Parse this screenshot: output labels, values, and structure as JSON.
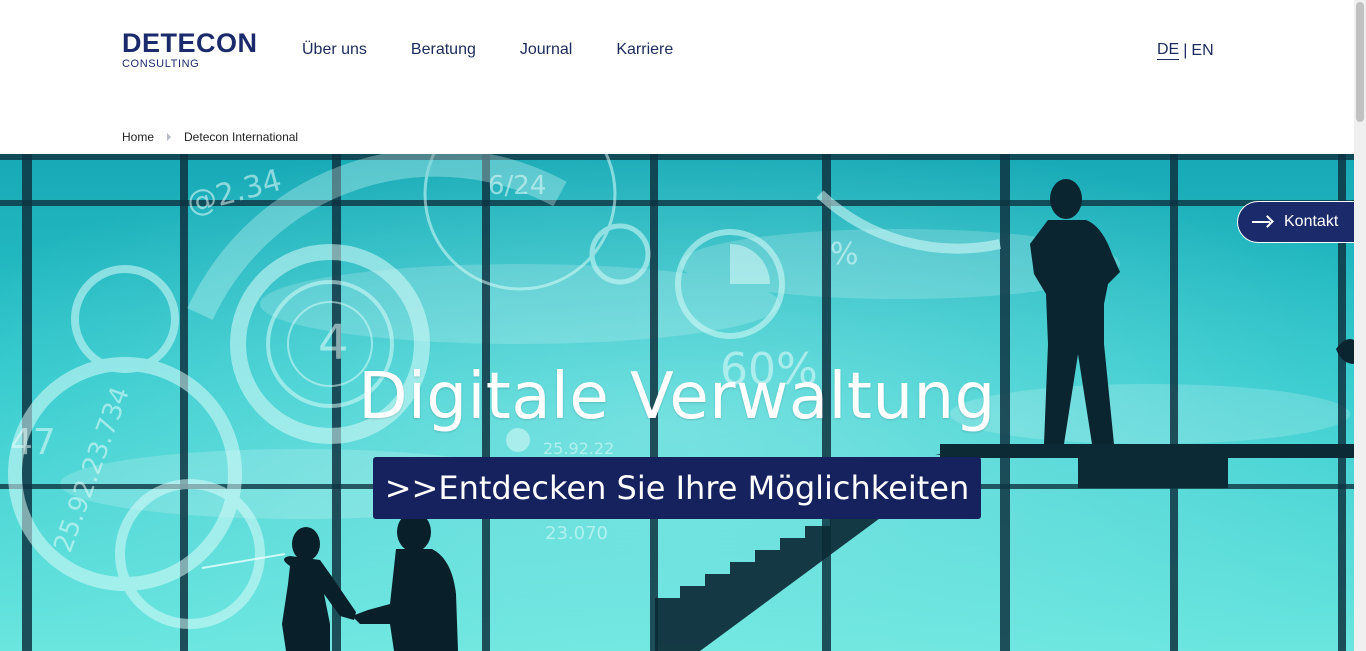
{
  "logo": {
    "main": "DETECON",
    "sub": "CONSULTING"
  },
  "nav": {
    "items": [
      "Über uns",
      "Beratung",
      "Journal",
      "Karriere"
    ]
  },
  "lang": {
    "de": "DE",
    "separator": "|",
    "en": "EN"
  },
  "breadcrumb": {
    "home": "Home",
    "current": "Detecon International"
  },
  "hero": {
    "title": "Digitale Verwaltung",
    "cta": ">>Entdecken Sie Ihre Möglichkeiten",
    "overlay_texts": [
      "@2.34",
      "6/24",
      "4",
      "25.92.23.734",
      "25.92.22",
      "23.070",
      "47",
      "%",
      "60%"
    ]
  },
  "kontakt": {
    "label": "Kontakt"
  },
  "colors": {
    "brand": "#1b2a6b",
    "cta_bg": "#16225e",
    "hero": "#2cc9cf"
  }
}
